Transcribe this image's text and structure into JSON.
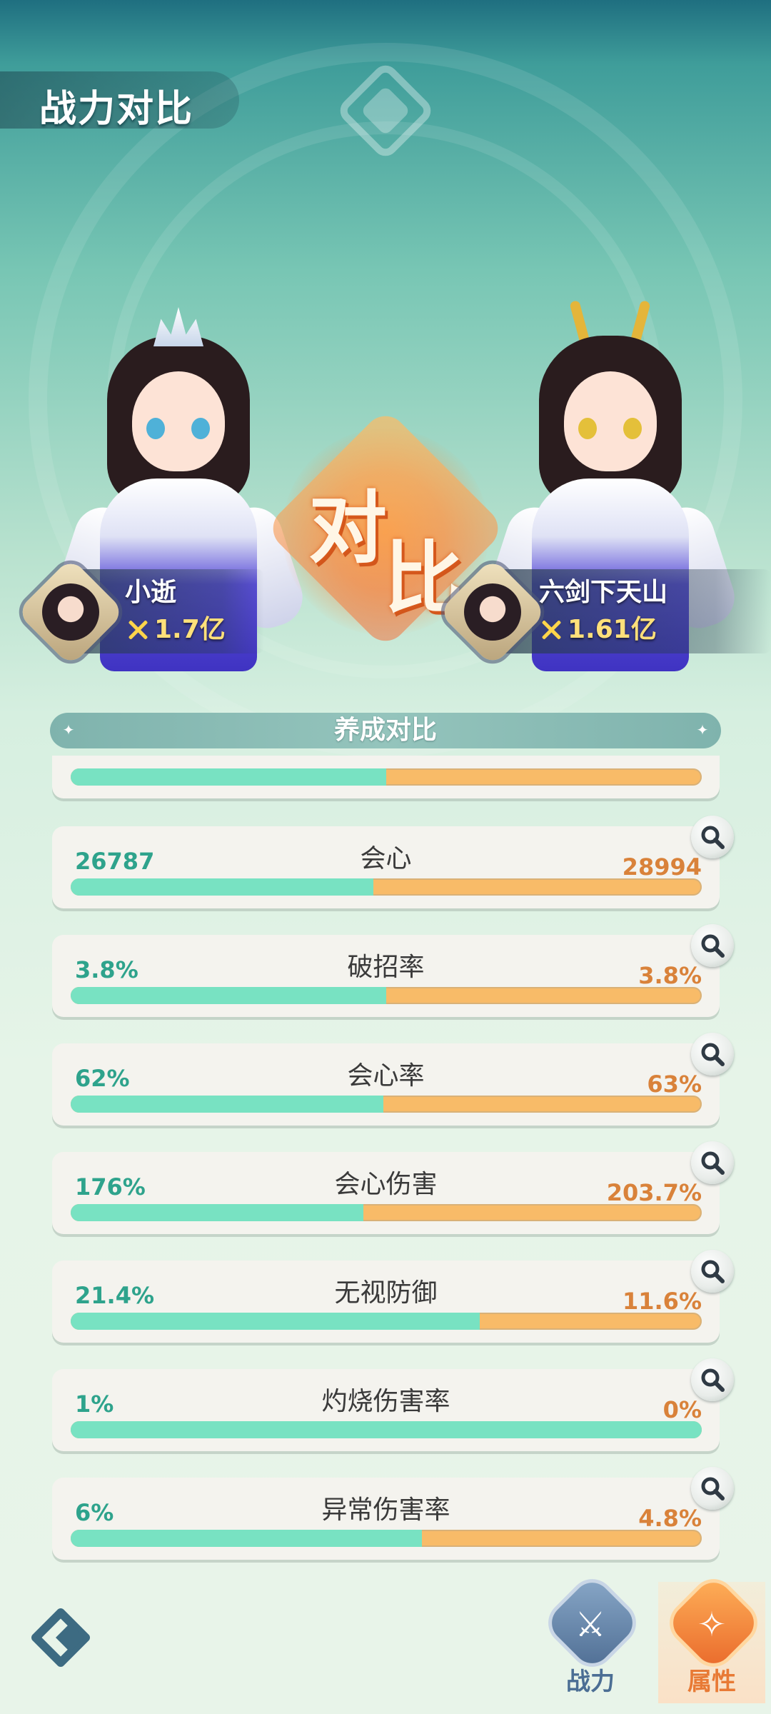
{
  "header": {
    "title": "战力对比"
  },
  "versus": {
    "char1": "对",
    "char2": "比"
  },
  "players": {
    "left": {
      "name": "小逝",
      "power": "1.7亿"
    },
    "right": {
      "name": "六剑下天山",
      "power": "1.61亿"
    }
  },
  "section": {
    "title": "养成对比"
  },
  "partial_row": {
    "left_share": 0.5
  },
  "stats": [
    {
      "name": "会心",
      "left": "26787",
      "right": "28994",
      "left_share": 0.48
    },
    {
      "name": "破招率",
      "left": "3.8%",
      "right": "3.8%",
      "left_share": 0.5
    },
    {
      "name": "会心率",
      "left": "62%",
      "right": "63%",
      "left_share": 0.496
    },
    {
      "name": "会心伤害",
      "left": "176%",
      "right": "203.7%",
      "left_share": 0.464
    },
    {
      "name": "无视防御",
      "left": "21.4%",
      "right": "11.6%",
      "left_share": 0.648
    },
    {
      "name": "灼烧伤害率",
      "left": "1%",
      "right": "0%",
      "left_share": 1.0
    },
    {
      "name": "异常伤害率",
      "left": "6%",
      "right": "4.8%",
      "left_share": 0.556
    }
  ],
  "nav": {
    "power_label": "战力",
    "attr_label": "属性"
  },
  "colors": {
    "left_bar": "#78e2c2",
    "right_bar": "#f8bb68",
    "left_text": "#2ea38c",
    "right_text": "#d9823a"
  },
  "icons": {
    "magnifier": "magnifier-icon",
    "back": "back-arrow-icon",
    "power_tab": "swords-icon",
    "attr_tab": "shield-star-icon"
  }
}
